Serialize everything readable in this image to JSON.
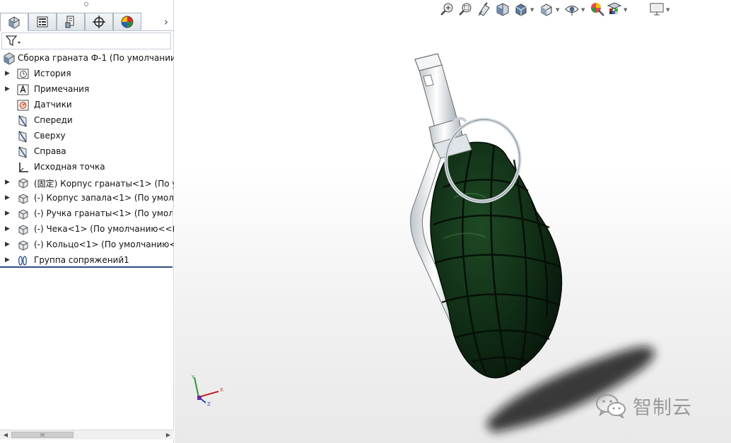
{
  "feature_tree": {
    "filter_icon": "funnel-icon",
    "tabs": [
      {
        "name": "feature-manager",
        "icon": "assembly-tab-icon"
      },
      {
        "name": "property-manager",
        "icon": "property-tab-icon"
      },
      {
        "name": "configuration-manager",
        "icon": "configuration-tab-icon"
      },
      {
        "name": "dim-xpert",
        "icon": "crosshair-tab-icon"
      },
      {
        "name": "display-manager",
        "icon": "appearance-tab-icon"
      }
    ],
    "root": {
      "label": "Сборка граната Ф-1  (По умолчании"
    },
    "items": [
      {
        "label": "История",
        "icon": "history-icon",
        "expandable": true
      },
      {
        "label": "Примечания",
        "icon": "annotations-icon",
        "expandable": true
      },
      {
        "label": "Датчики",
        "icon": "sensors-icon",
        "expandable": false
      },
      {
        "label": "Спереди",
        "icon": "plane-icon",
        "expandable": false
      },
      {
        "label": "Сверху",
        "icon": "plane-icon",
        "expandable": false
      },
      {
        "label": "Справа",
        "icon": "plane-icon",
        "expandable": false
      },
      {
        "label": "Исходная точка",
        "icon": "origin-icon",
        "expandable": false
      },
      {
        "label": "(固定) Корпус гранаты<1> (По ум",
        "icon": "part-icon",
        "expandable": true
      },
      {
        "label": "(-) Корпус запала<1> (По умолч",
        "icon": "part-icon",
        "expandable": true
      },
      {
        "label": "(-) Ручка гранаты<1> (По умолч",
        "icon": "part-icon",
        "expandable": true
      },
      {
        "label": "(-) Чека<1> (По умолчанию<<П",
        "icon": "part-icon",
        "expandable": true
      },
      {
        "label": "(-) Кольцо<1> (По умолчанию<",
        "icon": "part-icon",
        "expandable": true
      },
      {
        "label": "Группа сопряжений1",
        "icon": "mates-icon",
        "expandable": true
      }
    ],
    "scrollbar_thumb_label": "III"
  },
  "heads_up_toolbar": [
    {
      "name": "zoom-to-fit",
      "icon": "zoom-to-fit-icon"
    },
    {
      "name": "zoom-to-area",
      "icon": "zoom-area-icon"
    },
    {
      "name": "previous-view",
      "icon": "previous-view-icon"
    },
    {
      "name": "section-view",
      "icon": "section-view-icon"
    },
    {
      "name": "view-orientation",
      "icon": "view-orientation-icon",
      "dropdown": true
    },
    {
      "name": "display-style",
      "icon": "display-style-icon",
      "dropdown": true
    },
    {
      "name": "hide-show-items",
      "icon": "eye-icon",
      "dropdown": true
    },
    {
      "name": "edit-appearance",
      "icon": "appearance-icon"
    },
    {
      "name": "apply-scene",
      "icon": "scene-icon",
      "dropdown": true
    },
    {
      "name": "view-settings",
      "icon": "monitor-icon",
      "dropdown": true
    }
  ],
  "triad": {
    "x_label": "X",
    "y_label": "Y",
    "z_label": "Z"
  },
  "watermark": {
    "text": "智制云",
    "icon": "wechat-icon"
  },
  "colors": {
    "grenade_body": "#0f2a14",
    "metal": "#e8ecef",
    "accent": "#2f4f7f"
  }
}
